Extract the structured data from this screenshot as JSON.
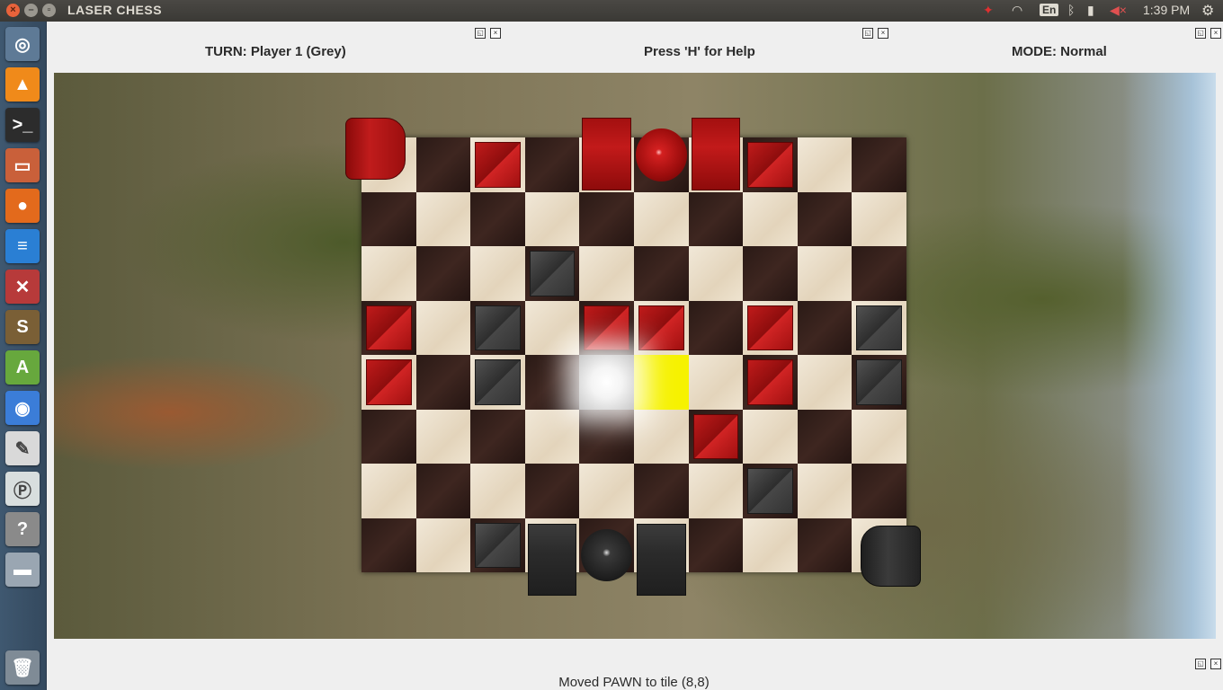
{
  "topbar": {
    "title": "LASER CHESS",
    "lang": "En",
    "clock": "1:39 PM"
  },
  "header": {
    "turn": "TURN: Player 1 (Grey)",
    "help": "Press 'H' for Help",
    "mode": "MODE: Normal"
  },
  "status": {
    "message": "Moved PAWN to tile (8,8)"
  },
  "launcher": [
    {
      "name": "ubuntu-dash",
      "glyph": "◎",
      "color": "#5e7a96"
    },
    {
      "name": "vlc",
      "glyph": "▲",
      "color": "#f08a1a"
    },
    {
      "name": "terminal",
      "glyph": ">_",
      "color": "#2c2c2c"
    },
    {
      "name": "files",
      "glyph": "▭",
      "color": "#c9603a"
    },
    {
      "name": "firefox",
      "glyph": "●",
      "color": "#e36a1c"
    },
    {
      "name": "writer",
      "glyph": "≡",
      "color": "#2a7fd4"
    },
    {
      "name": "settings",
      "glyph": "✕",
      "color": "#b73a3a"
    },
    {
      "name": "sublime",
      "glyph": "S",
      "color": "#7a5f36"
    },
    {
      "name": "android-studio",
      "glyph": "A",
      "color": "#67a83d"
    },
    {
      "name": "chromium",
      "glyph": "◉",
      "color": "#3b7dd8"
    },
    {
      "name": "text-editor",
      "glyph": "✎",
      "color": "#d9d9d9"
    },
    {
      "name": "pdf-viewer",
      "glyph": "Ⓟ",
      "color": "#d8dede"
    },
    {
      "name": "help",
      "glyph": "?",
      "color": "#8a8a8a"
    },
    {
      "name": "drive",
      "glyph": "▬",
      "color": "#9aa6b2"
    },
    {
      "name": "trash",
      "glyph": "🗑",
      "color": "#7f8b96"
    }
  ],
  "colors": {
    "red_piece": "#b01414",
    "grey_piece": "#333333",
    "highlight_target": "#f6f200",
    "highlight_laser": "#ffffff"
  },
  "board": {
    "cols": 10,
    "rows": 8,
    "highlights": [
      {
        "col": 4,
        "row": 4,
        "type": "white"
      },
      {
        "col": 5,
        "row": 4,
        "type": "yellow"
      }
    ],
    "pieces": [
      {
        "col": 0,
        "row": 0,
        "player": "red",
        "kind": "cylinder"
      },
      {
        "col": 2,
        "row": 0,
        "player": "red",
        "kind": "deflector"
      },
      {
        "col": 4,
        "row": 0,
        "player": "red",
        "kind": "block"
      },
      {
        "col": 5,
        "row": 0,
        "player": "red",
        "kind": "sphere"
      },
      {
        "col": 6,
        "row": 0,
        "player": "red",
        "kind": "block"
      },
      {
        "col": 7,
        "row": 0,
        "player": "red",
        "kind": "deflector"
      },
      {
        "col": 3,
        "row": 2,
        "player": "grey",
        "kind": "deflector"
      },
      {
        "col": 0,
        "row": 3,
        "player": "red",
        "kind": "deflector"
      },
      {
        "col": 2,
        "row": 3,
        "player": "grey",
        "kind": "deflector"
      },
      {
        "col": 4,
        "row": 3,
        "player": "red",
        "kind": "deflector"
      },
      {
        "col": 5,
        "row": 3,
        "player": "red",
        "kind": "deflector"
      },
      {
        "col": 7,
        "row": 3,
        "player": "red",
        "kind": "deflector"
      },
      {
        "col": 9,
        "row": 3,
        "player": "grey",
        "kind": "deflector"
      },
      {
        "col": 0,
        "row": 4,
        "player": "red",
        "kind": "deflector"
      },
      {
        "col": 2,
        "row": 4,
        "player": "grey",
        "kind": "deflector"
      },
      {
        "col": 7,
        "row": 4,
        "player": "red",
        "kind": "deflector"
      },
      {
        "col": 9,
        "row": 4,
        "player": "grey",
        "kind": "deflector"
      },
      {
        "col": 6,
        "row": 5,
        "player": "red",
        "kind": "deflector"
      },
      {
        "col": 7,
        "row": 6,
        "player": "grey",
        "kind": "deflector"
      },
      {
        "col": 2,
        "row": 7,
        "player": "grey",
        "kind": "deflector"
      },
      {
        "col": 3,
        "row": 7,
        "player": "grey",
        "kind": "block"
      },
      {
        "col": 4,
        "row": 7,
        "player": "grey",
        "kind": "sphere"
      },
      {
        "col": 5,
        "row": 7,
        "player": "grey",
        "kind": "block"
      },
      {
        "col": 9,
        "row": 7,
        "player": "grey",
        "kind": "cylinder"
      }
    ]
  }
}
